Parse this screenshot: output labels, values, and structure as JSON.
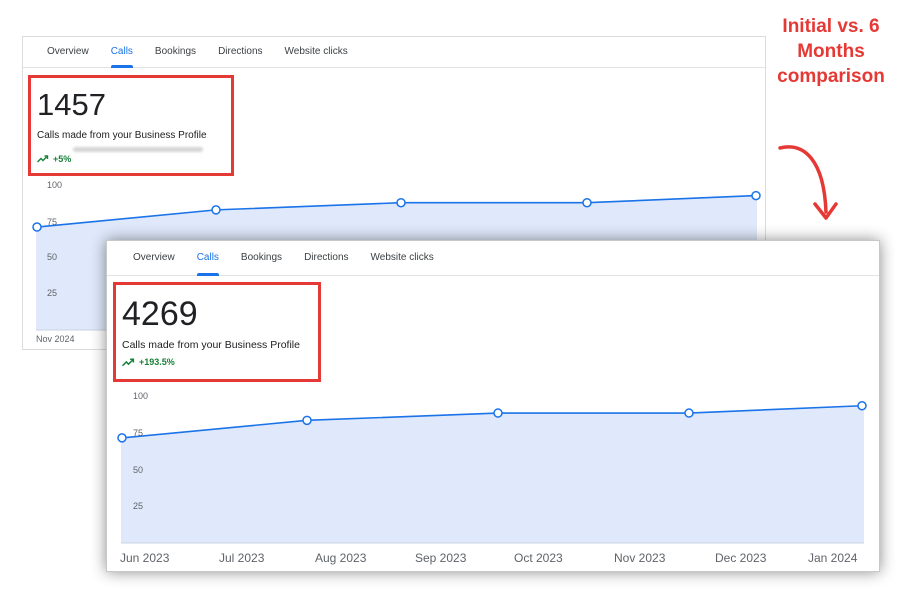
{
  "annotation": {
    "text": "Initial vs. 6 Months comparison",
    "color": "#e53935"
  },
  "colors": {
    "accent": "#1a73e8",
    "positive": "#188038",
    "highlight": "#e53935",
    "fill": "#dfe9fb"
  },
  "tabs": [
    "Overview",
    "Calls",
    "Bookings",
    "Directions",
    "Website clicks"
  ],
  "active_tab": "Calls",
  "initial": {
    "count": "1457",
    "description": "Calls made from your Business Profile",
    "change": "+5%",
    "y_ticks": [
      "100",
      "75",
      "50",
      "25"
    ],
    "x_tick_first": "Nov 2024"
  },
  "current": {
    "count": "4269",
    "description": "Calls made from your Business Profile",
    "change": "+193.5%",
    "y_ticks": [
      "100",
      "75",
      "50",
      "25"
    ],
    "x_ticks": [
      "Jun 2023",
      "Jul 2023",
      "Aug 2023",
      "Sep 2023",
      "Oct 2023",
      "Nov 2023",
      "Dec 2023",
      "Jan 2024"
    ]
  },
  "chart_data": [
    {
      "type": "area",
      "title": "",
      "xlabel": "",
      "ylabel": "",
      "ylim": [
        0,
        100
      ],
      "x_first_label": "Nov 2024",
      "values": [
        72,
        84,
        89,
        89,
        94
      ]
    },
    {
      "type": "area",
      "title": "",
      "xlabel": "",
      "ylabel": "",
      "ylim": [
        0,
        100
      ],
      "x": [
        "Jun 2023",
        "Jul 2023",
        "Aug 2023",
        "Sep 2023",
        "Oct 2023",
        "Nov 2023",
        "Dec 2023",
        "Jan 2024"
      ],
      "values": [
        72,
        84,
        89,
        89,
        94
      ]
    }
  ]
}
